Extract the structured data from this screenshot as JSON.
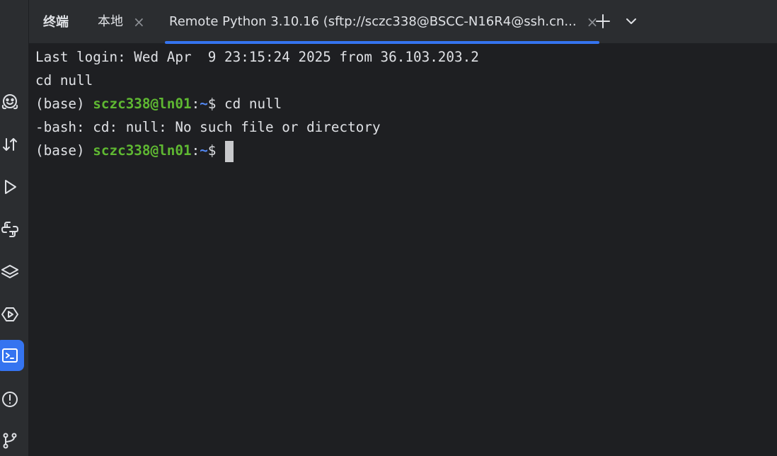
{
  "sidebar": {
    "items": [
      {
        "name": "huggingface-icon",
        "active": false
      },
      {
        "name": "transfer-icon",
        "active": false
      },
      {
        "name": "run-icon",
        "active": false
      },
      {
        "name": "python-packages-icon",
        "active": false
      },
      {
        "name": "layers-icon",
        "active": false
      },
      {
        "name": "services-icon",
        "active": false
      },
      {
        "name": "terminal-icon",
        "active": true
      },
      {
        "name": "problems-icon",
        "active": false
      },
      {
        "name": "git-icon",
        "active": false
      }
    ]
  },
  "tabbar": {
    "tool_title": "终端",
    "tabs": [
      {
        "label": "本地",
        "close": "×",
        "selected": false
      },
      {
        "label": "Remote Python 3.10.16 (sftp://sczc338@BSCC-N16R4@ssh.cn...",
        "close": "×",
        "selected": true
      }
    ],
    "add_icon": "plus-icon",
    "dropdown_icon": "chevron-down-icon"
  },
  "terminal": {
    "lines": [
      {
        "text": "Last login: Wed Apr  9 23:15:24 2025 from 36.103.203.2"
      },
      {
        "text": "cd null"
      },
      {
        "prefix": "(base) ",
        "user_host": "sczc338@ln01",
        "sep": ":",
        "path": "~",
        "prompt": "$ ",
        "command": "cd null"
      },
      {
        "text": "-bash: cd: null: No such file or directory"
      },
      {
        "prefix": "(base) ",
        "user_host": "sczc338@ln01",
        "sep": ":",
        "path": "~",
        "prompt": "$ ",
        "command": ""
      }
    ]
  },
  "colors": {
    "accent": "#3574f0",
    "background": "#1e1f22",
    "panel": "#2b2d30",
    "prompt_user": "#5fb832",
    "prompt_path": "#548af7"
  }
}
